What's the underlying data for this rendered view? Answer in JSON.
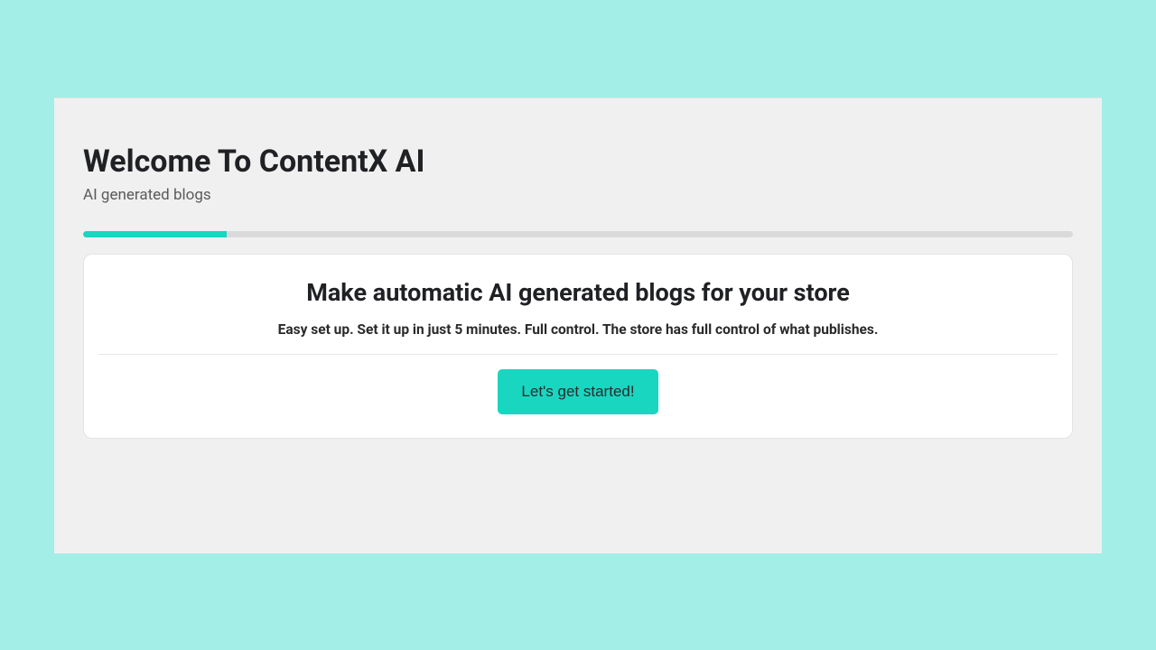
{
  "header": {
    "title": "Welcome To ContentX AI",
    "subtitle": "AI generated blogs"
  },
  "progress": {
    "percent": 14.5
  },
  "card": {
    "heading": "Make automatic AI generated blogs for your store",
    "subtext": "Easy set up. Set it up in just 5 minutes. Full control. The store has full control of what publishes.",
    "cta_label": "Let's get started!"
  },
  "colors": {
    "background": "#a3eee6",
    "panel": "#f0f0f0",
    "accent": "#19d6c1"
  }
}
